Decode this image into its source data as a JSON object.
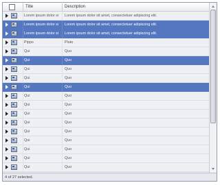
{
  "columns": {
    "title": "Title",
    "description": "Description"
  },
  "rows": [
    {
      "title": "Lorem ipsum dolor sit amet",
      "description": "Lorem ipsum dolor sit amet, consectetuer adipiscing elit.",
      "selected": false
    },
    {
      "title": "Lorem ipsum dolor sit amet",
      "description": "Lorem ipsum dolor sit amet, consectetuer adipiscing elit.",
      "selected": true
    },
    {
      "title": "Lorem ipsum dolor sit amet",
      "description": "Lorem ipsum dolor sit amet, consectetuer adipiscing elit.",
      "selected": true
    },
    {
      "title": "Pippo",
      "description": "Pluto",
      "selected": false
    },
    {
      "title": "Qui",
      "description": "Quo",
      "selected": false
    },
    {
      "title": "Qui",
      "description": "Quo",
      "selected": true
    },
    {
      "title": "Qui",
      "description": "Quo",
      "selected": false
    },
    {
      "title": "Qui",
      "description": "Quo",
      "selected": false
    },
    {
      "title": "Qui",
      "description": "Quo",
      "selected": true
    },
    {
      "title": "Qui",
      "description": "Quo",
      "selected": false
    },
    {
      "title": "Qui",
      "description": "Quo",
      "selected": false
    },
    {
      "title": "Qui",
      "description": "Quo",
      "selected": false
    },
    {
      "title": "Qui",
      "description": "Quo",
      "selected": false
    },
    {
      "title": "Qui",
      "description": "Quo",
      "selected": false
    },
    {
      "title": "Qui",
      "description": "Quo",
      "selected": false
    },
    {
      "title": "Qui",
      "description": "Quo",
      "selected": false
    },
    {
      "title": "Qui",
      "description": "Quo",
      "selected": false
    },
    {
      "title": "Qui",
      "description": "Quo",
      "selected": false
    }
  ],
  "status": {
    "text": "4 of 27 selected."
  },
  "colors": {
    "selection": "#5577c0",
    "background": "#eef0f4"
  },
  "icons": {
    "expander": "triangle-right-icon",
    "row": "item-icon"
  }
}
